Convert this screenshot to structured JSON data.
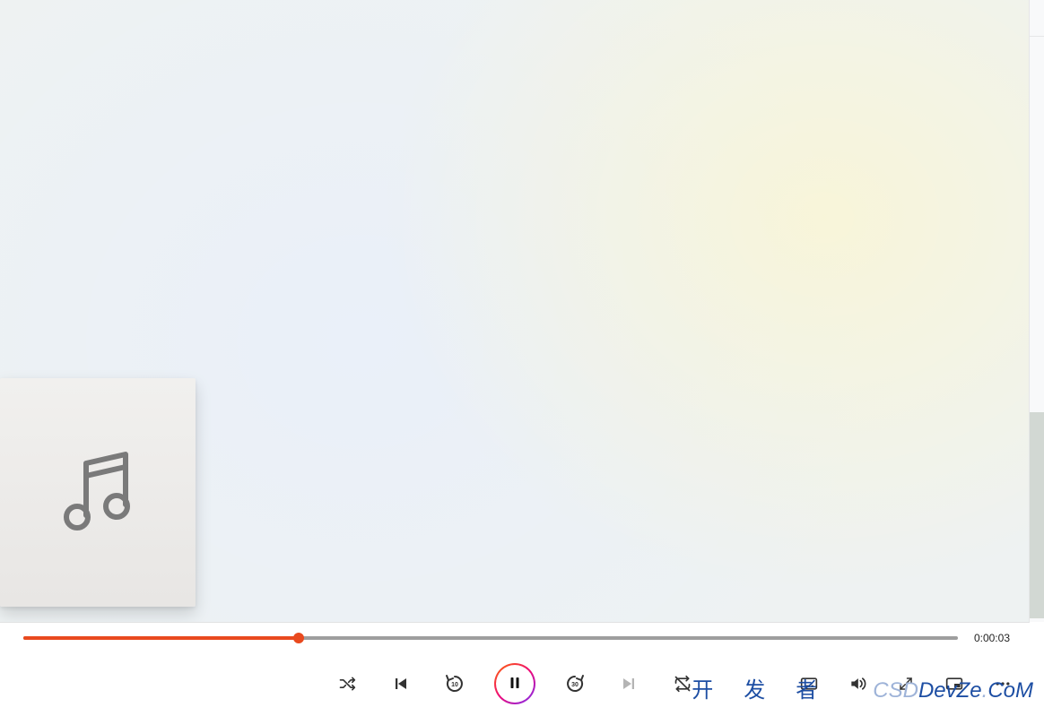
{
  "player": {
    "time_display": "0:00:03",
    "progress_percent": 29.5
  },
  "controls": {
    "shuffle": "shuffle",
    "previous": "previous",
    "skip_back_label": "10",
    "skip_forward_label": "30",
    "pause": "pause",
    "next": "next",
    "repeat": "repeat-off",
    "cast": "cast",
    "volume": "volume",
    "fullscreen": "fullscreen",
    "miniplayer": "mini-player",
    "more": "more"
  },
  "watermark": {
    "cn": "开发者",
    "en_prefix": "CSD",
    "en_main": "DevZe",
    "en_dot": ".",
    "en_suffix": "CoM"
  }
}
